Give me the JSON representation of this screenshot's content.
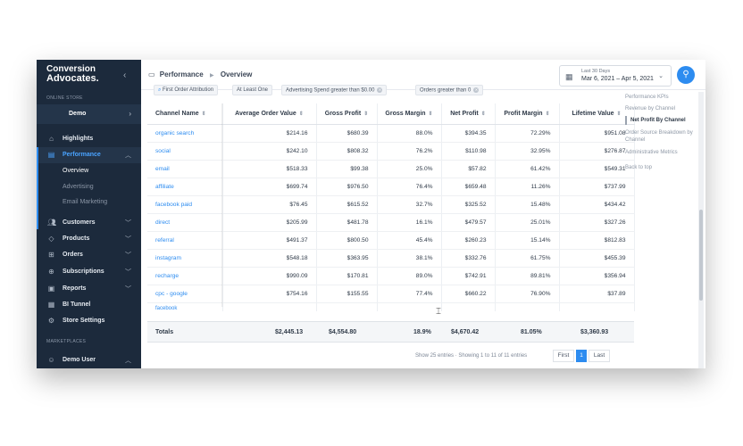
{
  "sidebar": {
    "logo_line1": "Conversion",
    "logo_line2": "Advocates.",
    "section_online_store": "ONLINE STORE",
    "store_name": "Demo",
    "items": [
      {
        "label": "Highlights"
      },
      {
        "label": "Performance"
      },
      {
        "label": "Customers"
      },
      {
        "label": "Products"
      },
      {
        "label": "Orders"
      },
      {
        "label": "Subscriptions"
      },
      {
        "label": "Reports"
      },
      {
        "label": "BI Tunnel"
      },
      {
        "label": "Store Settings"
      }
    ],
    "performance_sub": [
      "Overview",
      "Advertising",
      "Email Marketing"
    ],
    "section_marketplaces": "MARKETPLACES",
    "user_name": "Demo User"
  },
  "header": {
    "breadcrumb_section": "Performance",
    "breadcrumb_page": "Overview",
    "date_range_label": "Last 30 Days",
    "date_range_value": "Mar 6, 2021 – Apr 5, 2021"
  },
  "filters": [
    "First Order Attribution",
    "At Least One",
    "Advertising Spend greater than $0.00",
    "Orders greater than 0"
  ],
  "table": {
    "columns": [
      "Channel Name",
      "Average Order Value",
      "Gross Profit",
      "Gross Margin",
      "Net Profit",
      "Profit Margin",
      "Lifetime Value"
    ],
    "rows": [
      [
        "organic search",
        "$214.16",
        "$680.39",
        "88.0%",
        "$394.35",
        "72.29%",
        "$951.08"
      ],
      [
        "social",
        "$242.10",
        "$808.32",
        "76.2%",
        "$110.98",
        "32.95%",
        "$276.87"
      ],
      [
        "email",
        "$518.33",
        "$99.38",
        "25.0%",
        "$57.82",
        "61.42%",
        "$549.31"
      ],
      [
        "affiliate",
        "$699.74",
        "$976.50",
        "76.4%",
        "$659.48",
        "11.26%",
        "$737.99"
      ],
      [
        "facebook paid",
        "$76.45",
        "$615.52",
        "32.7%",
        "$325.52",
        "15.48%",
        "$434.42"
      ],
      [
        "direct",
        "$205.99",
        "$481.78",
        "16.1%",
        "$479.57",
        "25.01%",
        "$327.26"
      ],
      [
        "referral",
        "$491.37",
        "$800.50",
        "45.4%",
        "$260.23",
        "15.14%",
        "$812.83"
      ],
      [
        "instagram",
        "$548.18",
        "$363.95",
        "38.1%",
        "$332.76",
        "61.75%",
        "$455.39"
      ],
      [
        "recharge",
        "$990.09",
        "$170.81",
        "89.0%",
        "$742.91",
        "89.81%",
        "$356.94"
      ],
      [
        "cpc - google",
        "$754.16",
        "$155.55",
        "77.4%",
        "$660.22",
        "76.90%",
        "$37.89"
      ]
    ],
    "partial_row": "facebook",
    "totals": {
      "label": "Totals",
      "aov": "$2,445.13",
      "gross_profit": "$4,554.80",
      "gross_margin": "18.9%",
      "net_profit": "$4,670.42",
      "profit_margin": "81.05%",
      "ltv": "$3,360.93"
    },
    "pager_info": "Show 25 entries · Showing 1 to 11 of 11 entries",
    "pager": {
      "first": "First",
      "page": "1",
      "last": "Last"
    }
  },
  "rail": {
    "items": [
      "Performance KPIs",
      "Revenue by Channel",
      "Net Profit By Channel",
      "Order Source Breakdown by Channel",
      "Administrative Metrics",
      "Back to top"
    ]
  },
  "colors": {
    "sidebar_bg": "#1c2a3c",
    "accent": "#2d8cf0",
    "link": "#2d8cf0"
  }
}
